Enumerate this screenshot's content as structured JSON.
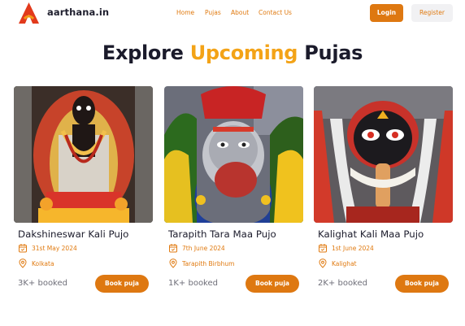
{
  "header": {
    "brand_name": "aarthana.in",
    "nav": [
      "Home",
      "Pujas",
      "About",
      "Contact Us"
    ],
    "login_label": "Login",
    "register_label": "Register"
  },
  "headline": {
    "part1": "Explore",
    "accent": "Upcoming",
    "part2": "Pujas"
  },
  "cards": [
    {
      "title": "Dakshineswar Kali Pujo",
      "date": "31st May 2024",
      "location": "Kolkata",
      "booked": "3K+ booked",
      "button": "Book puja"
    },
    {
      "title": "Tarapith Tara Maa Pujo",
      "date": "7th June 2024",
      "location": "Tarapith Birbhum",
      "booked": "1K+ booked",
      "button": "Book puja"
    },
    {
      "title": "Kalighat Kali Maa Pujo",
      "date": "1st June 2024",
      "location": "Kalighat",
      "booked": "2K+ booked",
      "button": "Book puja"
    }
  ],
  "colors": {
    "accent": "#de7811",
    "headline_accent": "#f3a317",
    "text": "#1b1b2b"
  }
}
